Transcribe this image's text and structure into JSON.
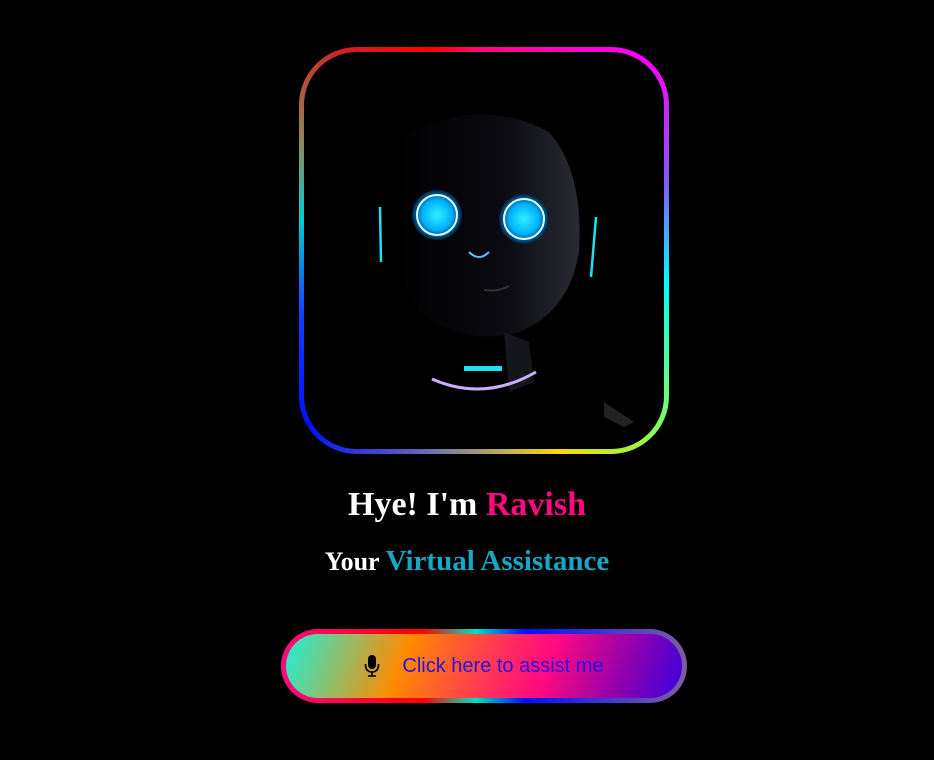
{
  "hero": {
    "image_alt": "robot-face-image"
  },
  "heading": {
    "greeting": "Hye! I'm",
    "name": "Ravish"
  },
  "subheading": {
    "prefix": "Your",
    "highlight": "Virtual Assistance"
  },
  "assist_button": {
    "label": "Click here to assist me",
    "icon": "microphone-icon"
  },
  "colors": {
    "name": "#ff0a7f",
    "highlight": "#17a7c6",
    "button_text": "#2a10e0",
    "background": "#000000"
  }
}
